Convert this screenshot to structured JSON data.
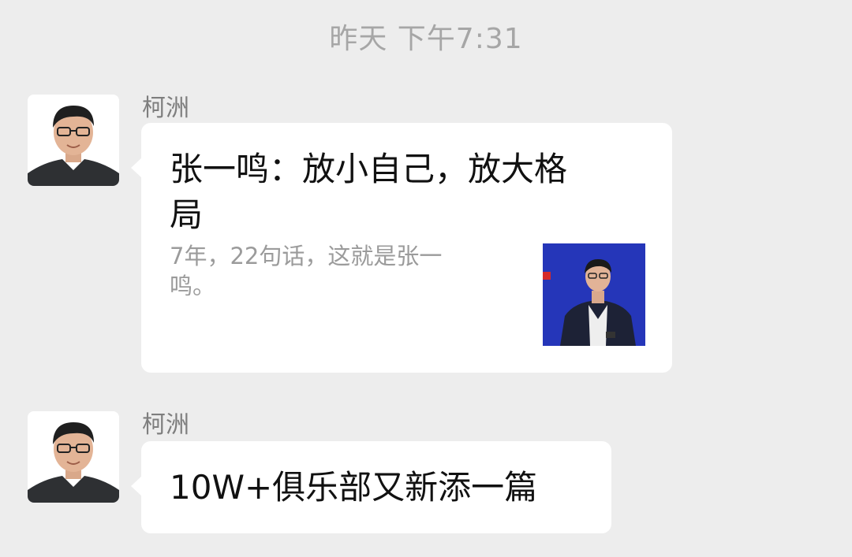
{
  "chat": {
    "timestamp": "昨天 下午7:31",
    "messages": [
      {
        "sender": "柯洲",
        "type": "link",
        "title": "张一鸣：放小自己，放大格局",
        "description": "7年，22句话，这就是张一鸣。"
      },
      {
        "sender": "柯洲",
        "type": "text",
        "text": "10W+俱乐部又新添一篇"
      }
    ]
  },
  "colors": {
    "background": "#ededed",
    "bubble": "#ffffff",
    "timestamp_text": "#a6a6a6",
    "sender_text": "#7e7e7e",
    "description_text": "#9b9b9b",
    "thumbnail_background": "#2b3fd0"
  },
  "icons": {
    "avatar": "avatar-photo",
    "thumbnail": "article-thumbnail-photo"
  }
}
